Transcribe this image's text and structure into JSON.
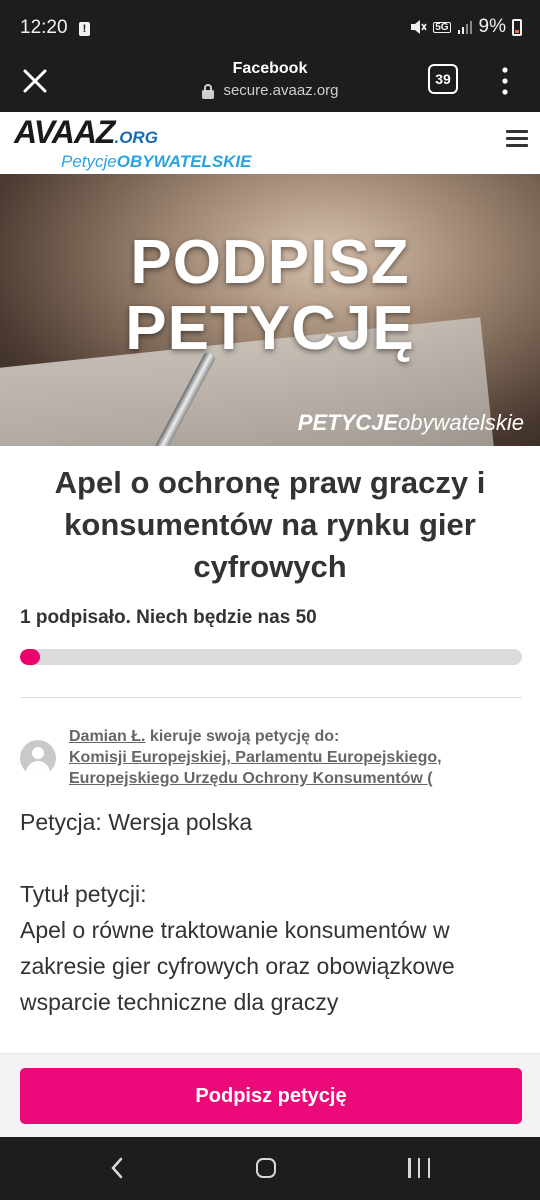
{
  "status_bar": {
    "time": "12:20",
    "network": "5G",
    "battery": "9%"
  },
  "browser": {
    "title": "Facebook",
    "url": "secure.avaaz.org",
    "tab_count": "39"
  },
  "site": {
    "logo_main": "AVAAZ",
    "logo_org": ".ORG",
    "logo_sub_light": "Petycje",
    "logo_sub_bold": "OBYWATELSKIE"
  },
  "hero": {
    "line1": "PODPISZ",
    "line2": "PETYCJĘ",
    "brand_bold": "PETYCJE",
    "brand_light": "obywatelskie"
  },
  "petition": {
    "title": "Apel o ochronę praw graczy i konsumentów na rynku gier cyfrowych",
    "progress_text": "1 podpisało. Niech będzie nas 50",
    "signatures": 1,
    "goal": 50,
    "author": "Damian Ł.",
    "directs_text": " kieruje swoją petycję do:",
    "recipients_line1": "Komisji Europejskiej, Parlamentu Europejskiego,",
    "recipients_line2": "Europejskiego Urzędu Ochrony Konsumentów (",
    "body_line1": "Petycja: Wersja polska",
    "body_heading": "Tytuł petycji:",
    "body_text": "Apel o równe traktowanie konsumentów w zakresie gier cyfrowych oraz obowiązkowe wsparcie techniczne dla graczy"
  },
  "cta": {
    "label": "Podpisz petycję",
    "color": "#ec0a7b"
  },
  "colors": {
    "accent": "#ec006f",
    "link": "#666666"
  }
}
